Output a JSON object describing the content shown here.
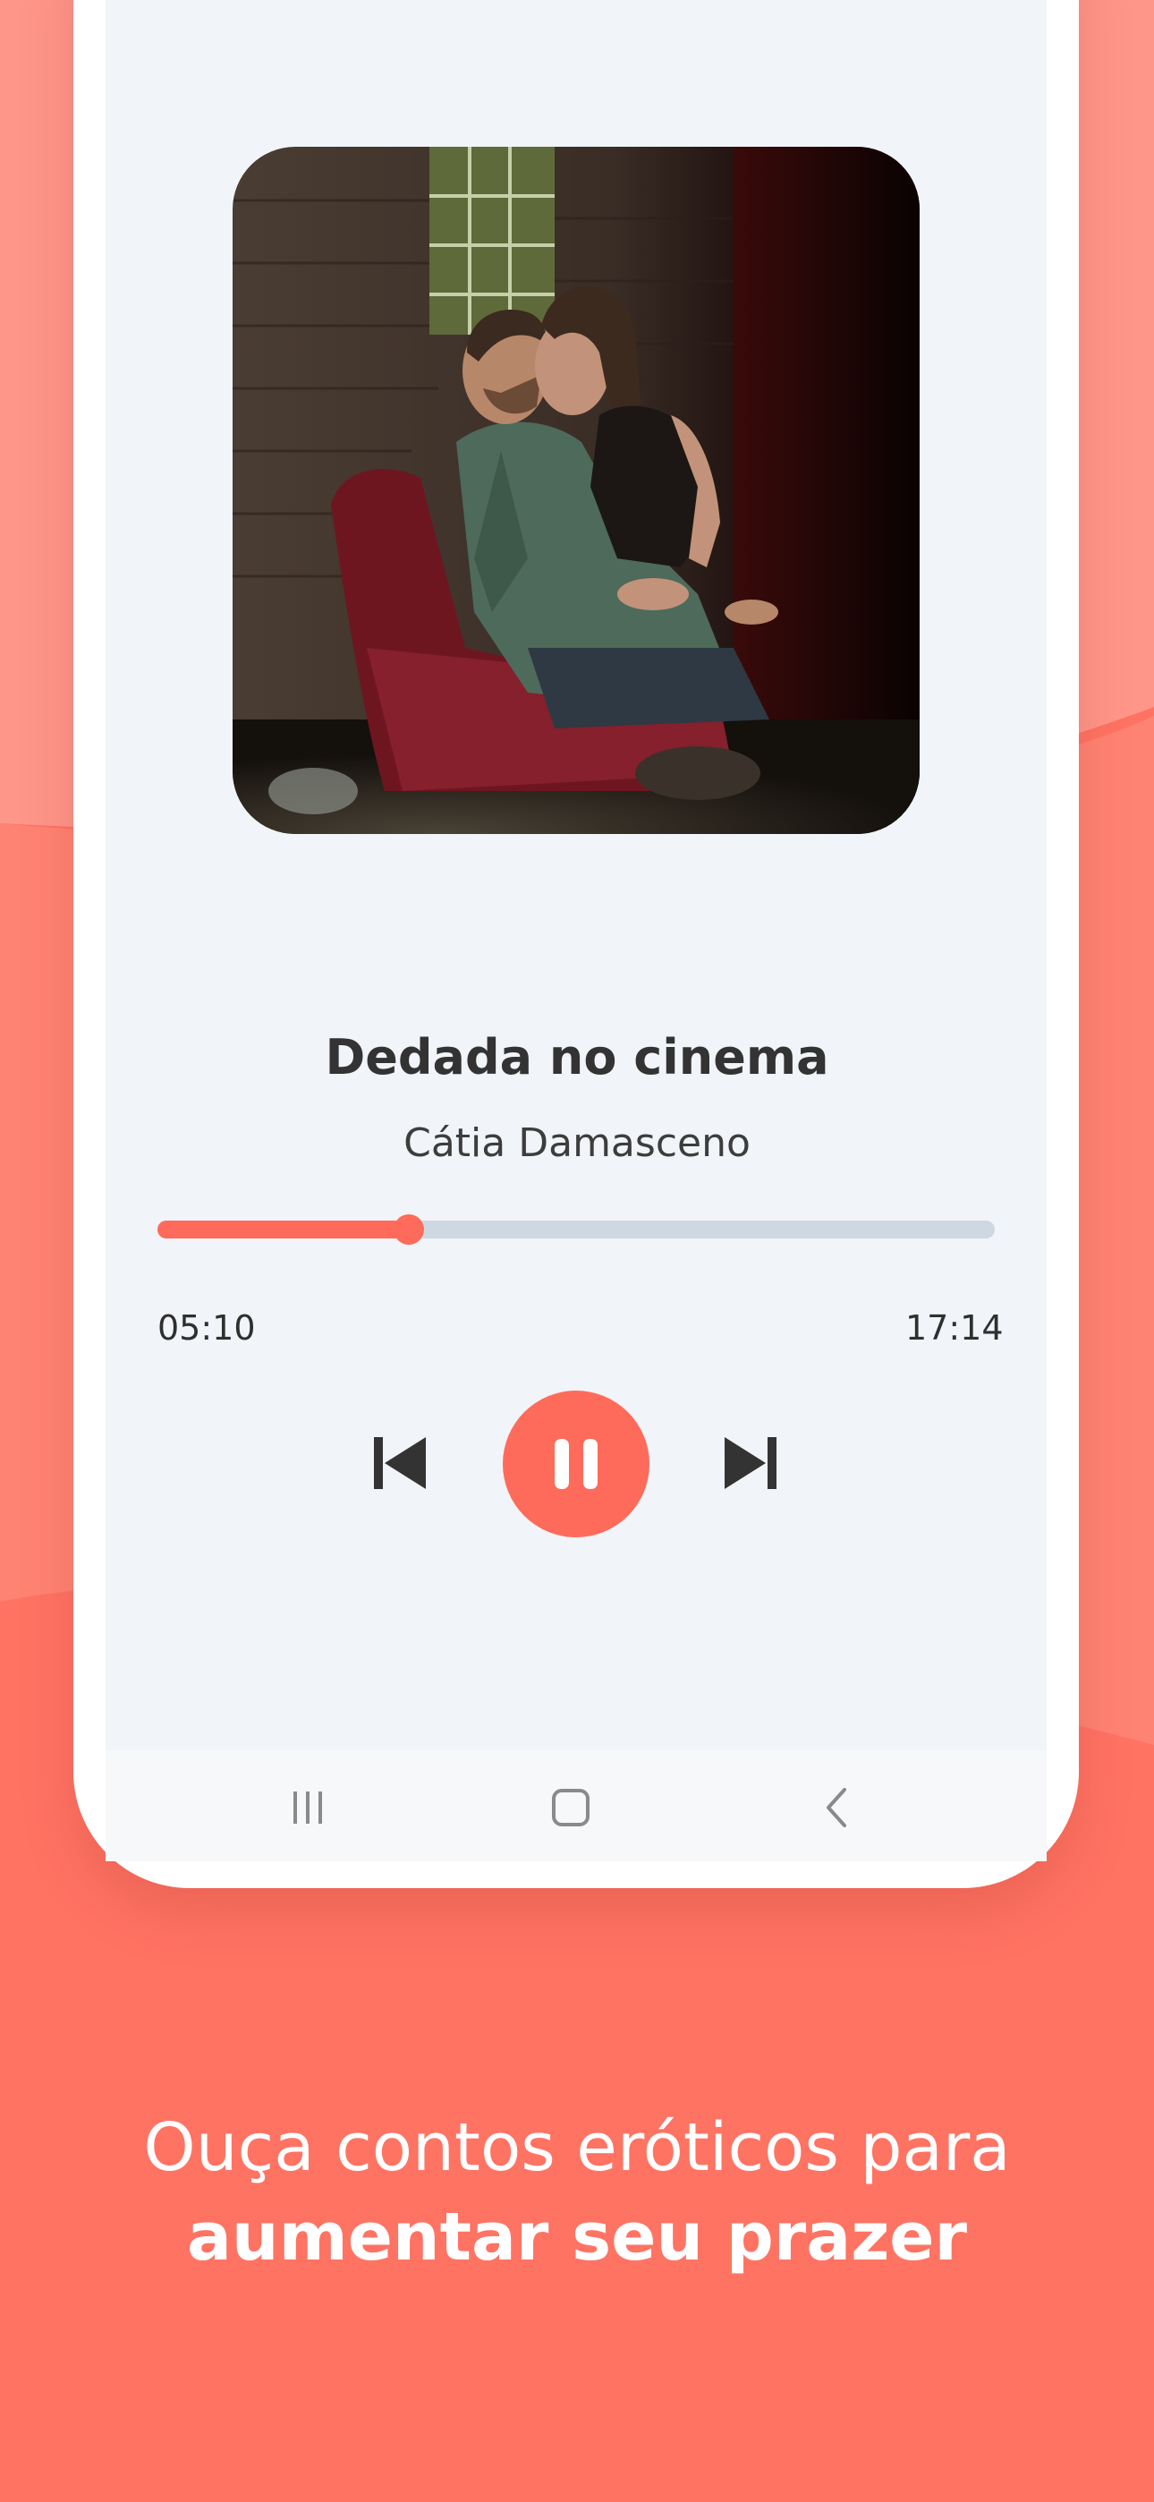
{
  "colors": {
    "background": "#ff7363",
    "accent": "#ff6b5a",
    "track": "#ced8e2",
    "screen": "#f1f4f8",
    "text_dark": "#333333"
  },
  "player": {
    "title": "Dedada no cinema",
    "artist": "Cátia Damasceno",
    "artwork_icon": "album-cover-image",
    "current_time": "05:10",
    "total_time": "17:14",
    "progress": 0.3,
    "prev_icon": "skip-previous-icon",
    "play_state_icon": "pause-icon",
    "next_icon": "skip-next-icon"
  },
  "system_nav": {
    "recents_icon": "recents-icon",
    "home_icon": "home-icon",
    "back_icon": "back-icon"
  },
  "caption": {
    "line1": "Ouça contos eróticos para",
    "line2": "aumentar seu prazer"
  }
}
